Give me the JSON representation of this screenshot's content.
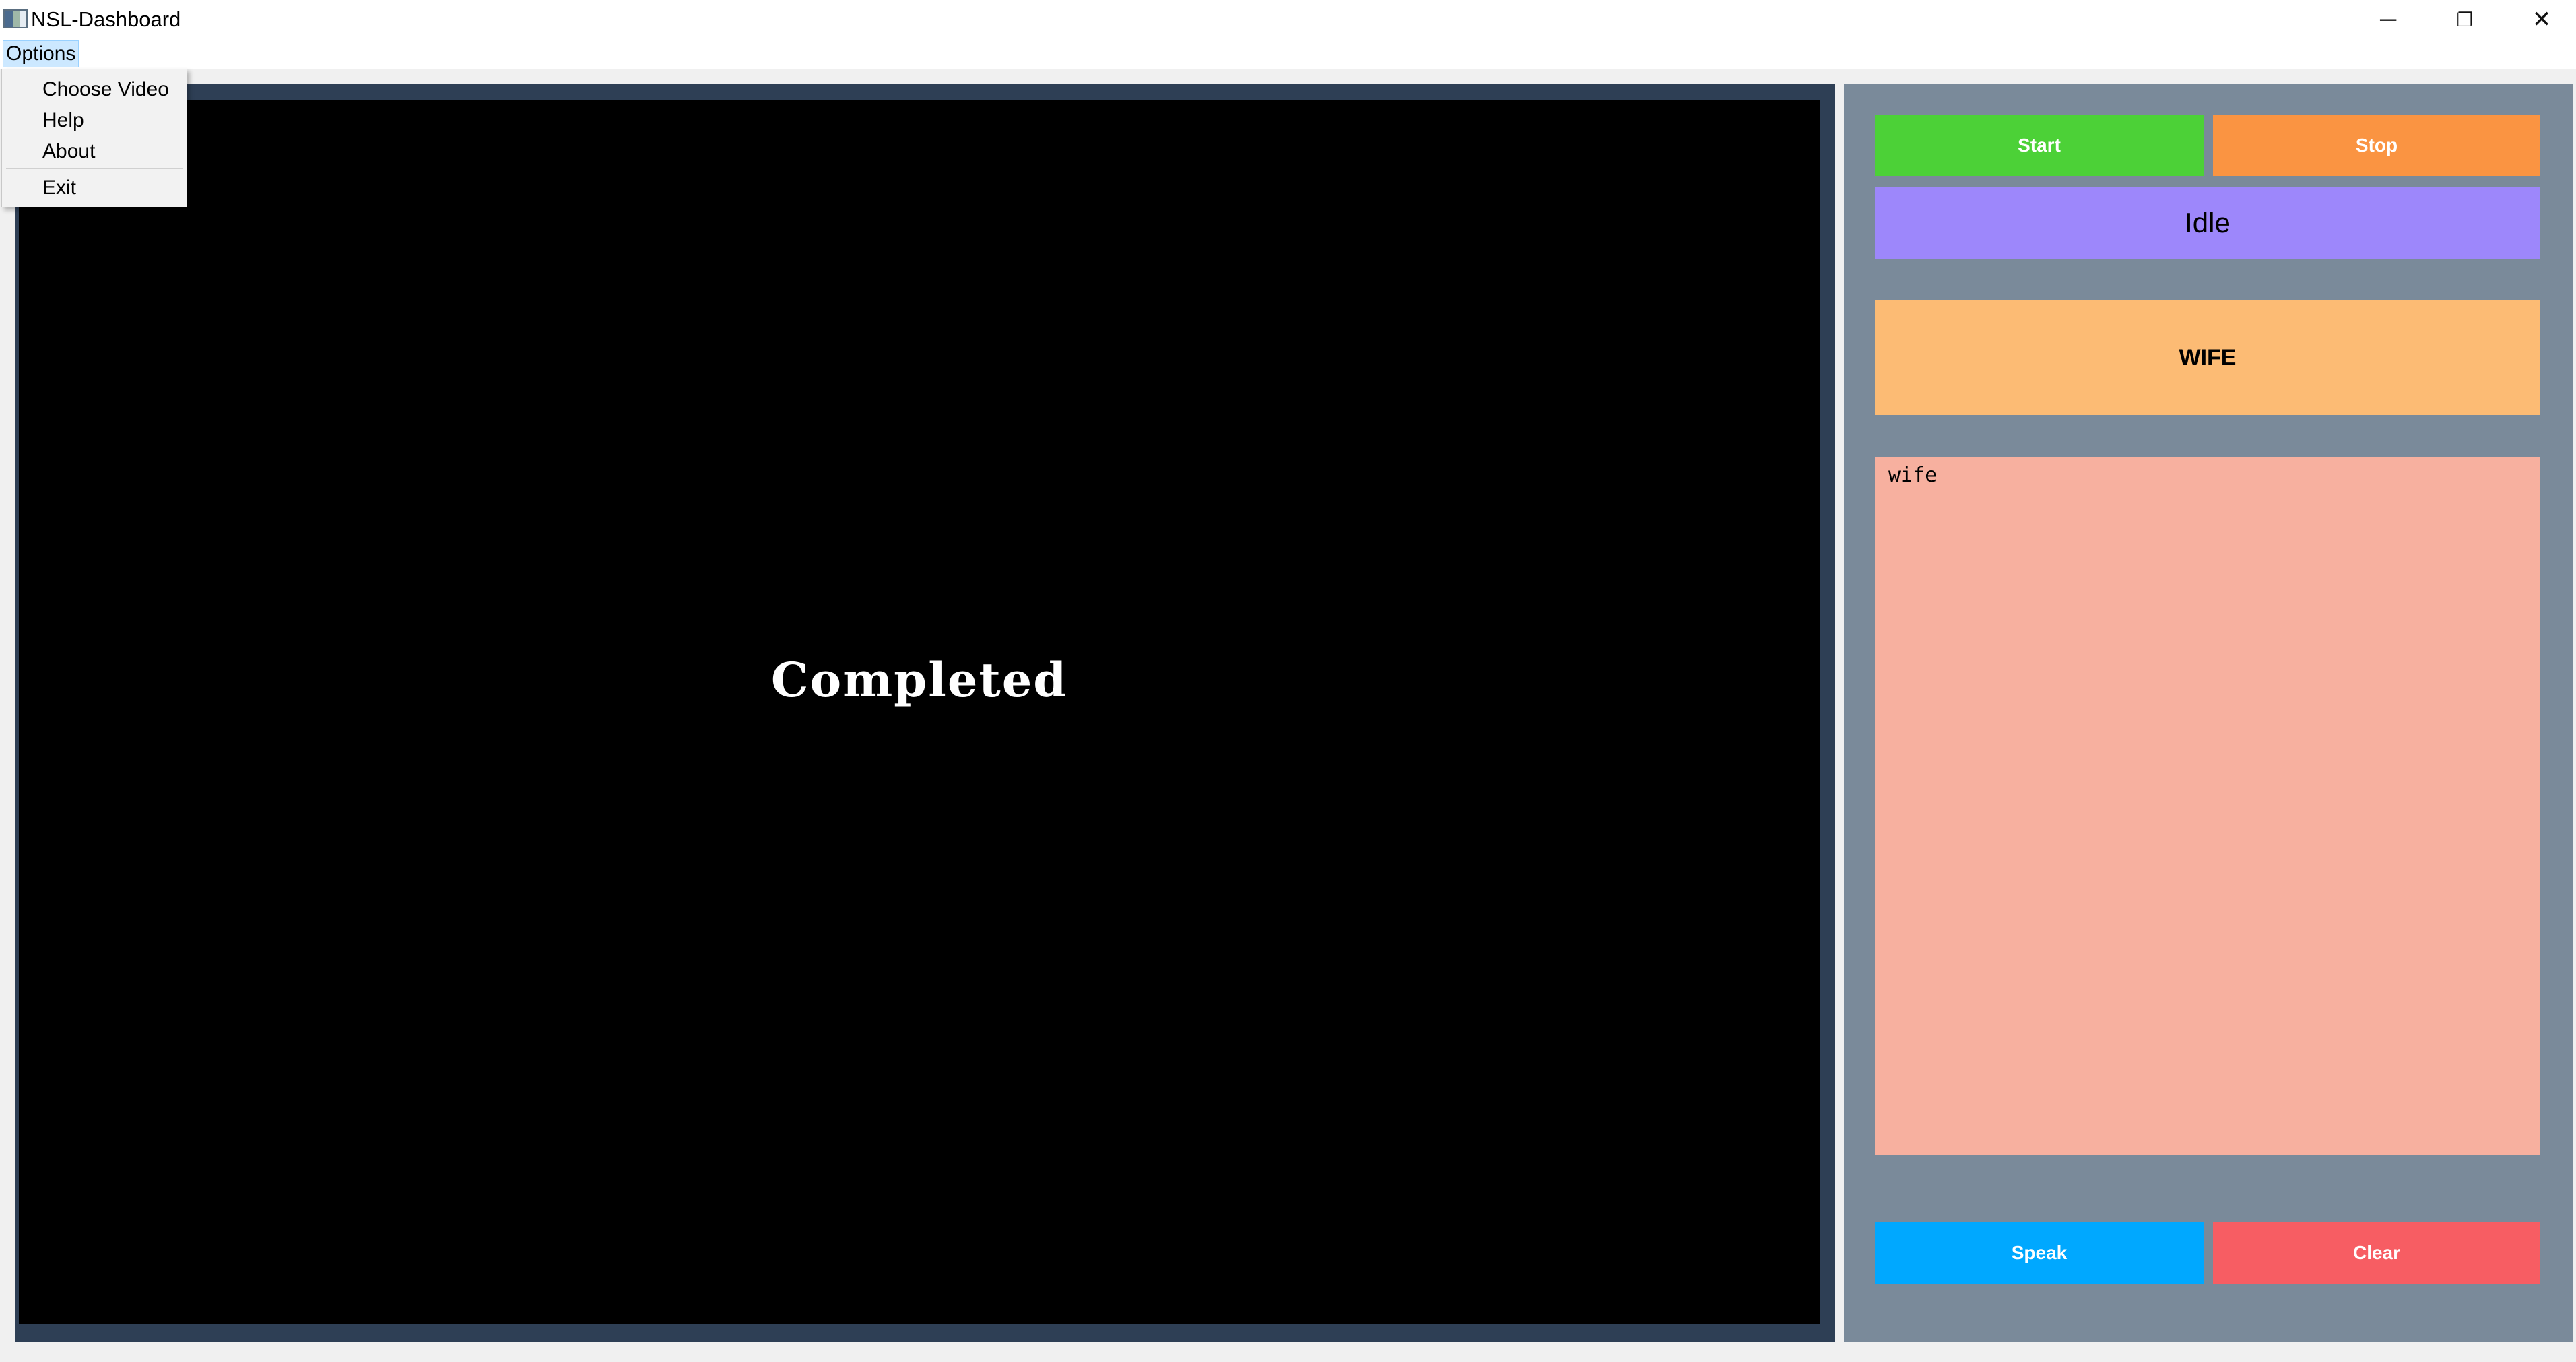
{
  "window": {
    "title": "NSL-Dashboard",
    "controls": {
      "minimize": "─",
      "restore": "❐",
      "close": "✕"
    }
  },
  "menubar": {
    "options_label": "Options"
  },
  "options_menu": {
    "items": [
      "Choose Video",
      "Help",
      "About",
      "Exit"
    ]
  },
  "video": {
    "overlay_text": "Completed"
  },
  "controls": {
    "start_label": "Start",
    "stop_label": "Stop",
    "speak_label": "Speak",
    "clear_label": "Clear"
  },
  "status": {
    "text": "Idle"
  },
  "prediction": {
    "word": "WIFE"
  },
  "transcript": {
    "text": "wife"
  },
  "colors": {
    "start": "#4cd137",
    "stop": "#fa9442",
    "status": "#9d87fb",
    "prediction": "#fcbb74",
    "transcript": "#f7b09f",
    "speak": "#00a8ff",
    "clear": "#f75d63",
    "panel": "#7a8a9a",
    "video_frame": "#2e3f55"
  },
  "icons": {
    "app": "app-window-icon",
    "minimize": "minimize-icon",
    "restore": "restore-icon",
    "close": "close-icon"
  }
}
